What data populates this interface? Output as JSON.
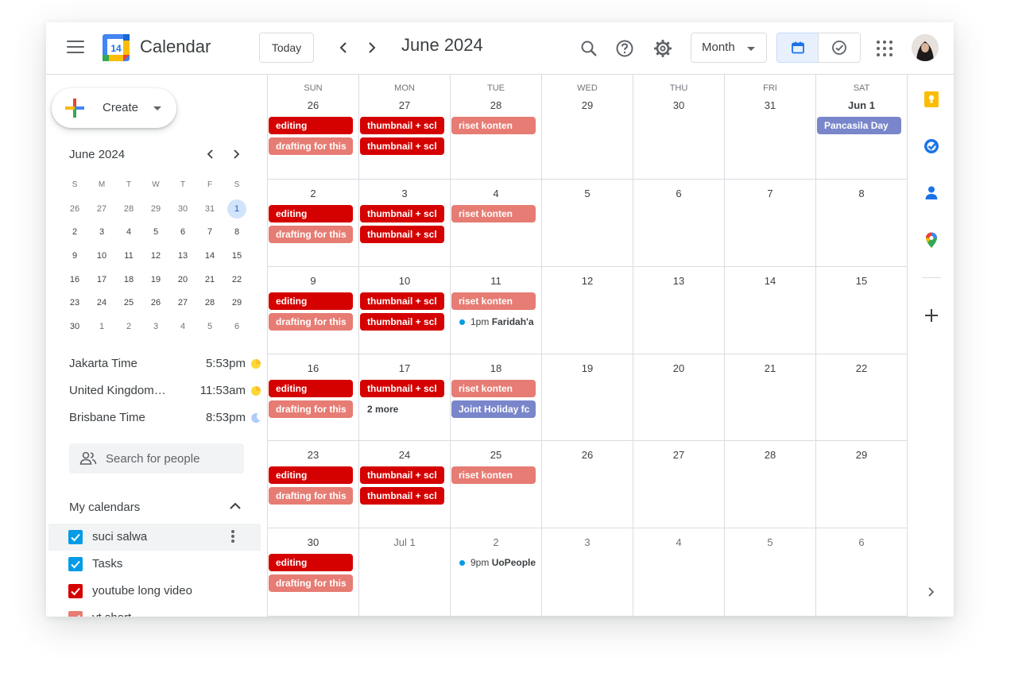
{
  "header": {
    "logo_day": "14",
    "app_title": "Calendar",
    "today_label": "Today",
    "month_title": "June 2024",
    "view_label": "Month"
  },
  "sidebar": {
    "create_label": "Create",
    "mini": {
      "title": "June 2024",
      "dow": [
        "S",
        "M",
        "T",
        "W",
        "T",
        "F",
        "S"
      ],
      "weeks": [
        [
          {
            "d": "26",
            "o": true
          },
          {
            "d": "27",
            "o": true
          },
          {
            "d": "28",
            "o": true
          },
          {
            "d": "29",
            "o": true
          },
          {
            "d": "30",
            "o": true
          },
          {
            "d": "31",
            "o": true
          },
          {
            "d": "1",
            "s": true
          }
        ],
        [
          {
            "d": "2"
          },
          {
            "d": "3"
          },
          {
            "d": "4"
          },
          {
            "d": "5"
          },
          {
            "d": "6"
          },
          {
            "d": "7"
          },
          {
            "d": "8"
          }
        ],
        [
          {
            "d": "9"
          },
          {
            "d": "10"
          },
          {
            "d": "11"
          },
          {
            "d": "12"
          },
          {
            "d": "13"
          },
          {
            "d": "14"
          },
          {
            "d": "15"
          }
        ],
        [
          {
            "d": "16"
          },
          {
            "d": "17"
          },
          {
            "d": "18"
          },
          {
            "d": "19"
          },
          {
            "d": "20"
          },
          {
            "d": "21"
          },
          {
            "d": "22"
          }
        ],
        [
          {
            "d": "23"
          },
          {
            "d": "24"
          },
          {
            "d": "25"
          },
          {
            "d": "26"
          },
          {
            "d": "27"
          },
          {
            "d": "28"
          },
          {
            "d": "29"
          }
        ],
        [
          {
            "d": "30"
          },
          {
            "d": "1",
            "o": true
          },
          {
            "d": "2",
            "o": true
          },
          {
            "d": "3",
            "o": true
          },
          {
            "d": "4",
            "o": true
          },
          {
            "d": "5",
            "o": true
          },
          {
            "d": "6",
            "o": true
          }
        ]
      ]
    },
    "clocks": [
      {
        "zone": "Jakarta Time",
        "time": "5:53pm",
        "icon": "sun-icon"
      },
      {
        "zone": "United Kingdom ...",
        "time": "11:53am",
        "icon": "sun-icon"
      },
      {
        "zone": "Brisbane Time",
        "time": "8:53pm",
        "icon": "moon-icon"
      }
    ],
    "search_people_placeholder": "Search for people",
    "my_calendars_title": "My calendars",
    "calendars": [
      {
        "name": "suci salwa",
        "color": "#039be5",
        "highlighted": true
      },
      {
        "name": "Tasks",
        "color": "#039be5"
      },
      {
        "name": "youtube long video",
        "color": "#d50000"
      },
      {
        "name": "yt short",
        "color": "#e67c73"
      }
    ]
  },
  "colors": {
    "dark_red": "#d50000",
    "light_red": "#e67c73",
    "holiday": "#7986cb",
    "dot_blue": "#039be5",
    "accent_blue": "#1a73e8"
  },
  "grid": {
    "dow": [
      "SUN",
      "MON",
      "TUE",
      "WED",
      "THU",
      "FRI",
      "SAT"
    ],
    "weeks": [
      [
        {
          "date": "26",
          "events": [
            {
              "t": "editing",
              "k": "dark"
            },
            {
              "t": "drafting for this",
              "k": "light"
            }
          ]
        },
        {
          "date": "27",
          "events": [
            {
              "t": "thumbnail + scl",
              "k": "dark"
            },
            {
              "t": "thumbnail + scl",
              "k": "dark"
            }
          ]
        },
        {
          "date": "28",
          "events": [
            {
              "t": "riset konten",
              "k": "light"
            }
          ]
        },
        {
          "date": "29",
          "events": []
        },
        {
          "date": "30",
          "events": []
        },
        {
          "date": "31",
          "events": []
        },
        {
          "date": "Jun 1",
          "bold": true,
          "events": [
            {
              "t": "Pancasila Day",
              "k": "purple"
            }
          ]
        }
      ],
      [
        {
          "date": "2",
          "events": [
            {
              "t": "editing",
              "k": "dark"
            },
            {
              "t": "drafting for this",
              "k": "light"
            }
          ]
        },
        {
          "date": "3",
          "events": [
            {
              "t": "thumbnail + scl",
              "k": "dark"
            },
            {
              "t": "thumbnail + scl",
              "k": "dark"
            }
          ]
        },
        {
          "date": "4",
          "events": [
            {
              "t": "riset konten",
              "k": "light"
            }
          ]
        },
        {
          "date": "5",
          "events": []
        },
        {
          "date": "6",
          "events": []
        },
        {
          "date": "7",
          "events": []
        },
        {
          "date": "8",
          "events": []
        }
      ],
      [
        {
          "date": "9",
          "events": [
            {
              "t": "editing",
              "k": "dark"
            },
            {
              "t": "drafting for this",
              "k": "light"
            }
          ]
        },
        {
          "date": "10",
          "events": [
            {
              "t": "thumbnail + scl",
              "k": "dark"
            },
            {
              "t": "thumbnail + scl",
              "k": "dark"
            }
          ]
        },
        {
          "date": "11",
          "events": [
            {
              "t": "riset konten",
              "k": "light"
            },
            {
              "t": "Faridah'a",
              "time": "1pm",
              "k": "dot"
            }
          ]
        },
        {
          "date": "12",
          "events": []
        },
        {
          "date": "13",
          "events": []
        },
        {
          "date": "14",
          "events": []
        },
        {
          "date": "15",
          "events": []
        }
      ],
      [
        {
          "date": "16",
          "events": [
            {
              "t": "editing",
              "k": "dark"
            },
            {
              "t": "drafting for this",
              "k": "light"
            }
          ]
        },
        {
          "date": "17",
          "events": [
            {
              "t": "thumbnail + scl",
              "k": "dark"
            },
            {
              "t": "2 more",
              "k": "moretxt"
            }
          ]
        },
        {
          "date": "18",
          "events": [
            {
              "t": "riset konten",
              "k": "light"
            },
            {
              "t": "Joint Holiday fc",
              "k": "purple"
            }
          ]
        },
        {
          "date": "19",
          "events": []
        },
        {
          "date": "20",
          "events": []
        },
        {
          "date": "21",
          "events": []
        },
        {
          "date": "22",
          "events": []
        }
      ],
      [
        {
          "date": "23",
          "events": [
            {
              "t": "editing",
              "k": "dark"
            },
            {
              "t": "drafting for this",
              "k": "light"
            }
          ]
        },
        {
          "date": "24",
          "events": [
            {
              "t": "thumbnail + scl",
              "k": "dark"
            },
            {
              "t": "thumbnail + scl",
              "k": "dark"
            }
          ]
        },
        {
          "date": "25",
          "events": [
            {
              "t": "riset konten",
              "k": "light"
            }
          ]
        },
        {
          "date": "26",
          "events": []
        },
        {
          "date": "27",
          "events": []
        },
        {
          "date": "28",
          "events": []
        },
        {
          "date": "29",
          "events": []
        }
      ],
      [
        {
          "date": "30",
          "events": [
            {
              "t": "editing",
              "k": "dark"
            },
            {
              "t": "drafting for this",
              "k": "light"
            }
          ]
        },
        {
          "date": "Jul 1",
          "other": true,
          "events": []
        },
        {
          "date": "2",
          "other": true,
          "events": [
            {
              "t": "UoPeople",
              "time": "9pm",
              "k": "dot"
            }
          ]
        },
        {
          "date": "3",
          "other": true,
          "events": []
        },
        {
          "date": "4",
          "other": true,
          "events": []
        },
        {
          "date": "5",
          "other": true,
          "events": []
        },
        {
          "date": "6",
          "other": true,
          "events": []
        }
      ]
    ]
  },
  "rail_icons": [
    "keep-icon",
    "tasks-icon",
    "contacts-icon",
    "maps-icon",
    "add-icon",
    "expand-icon"
  ]
}
